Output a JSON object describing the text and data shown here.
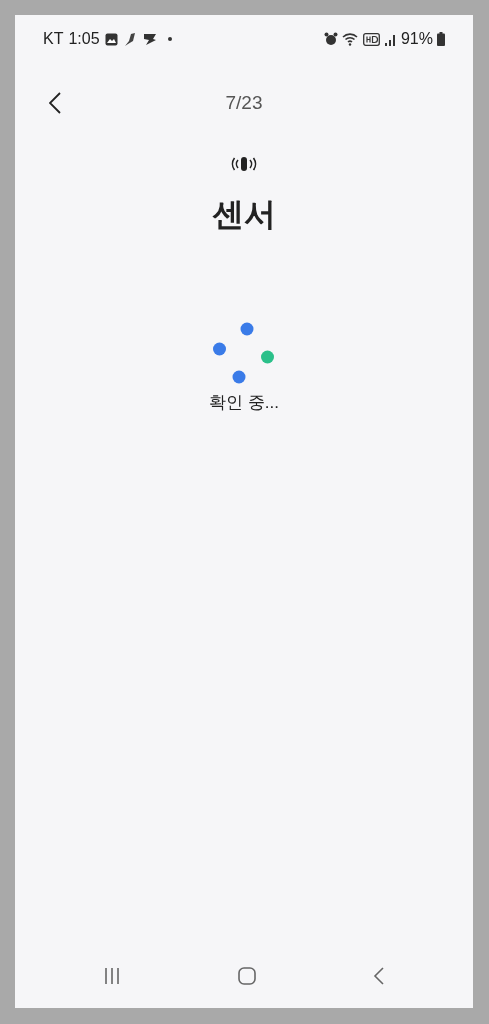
{
  "status_bar": {
    "carrier": "KT",
    "time": "1:05",
    "battery": "91%"
  },
  "header": {
    "step": "7/23"
  },
  "title": "센서",
  "loading": {
    "label": "확인 중..."
  }
}
